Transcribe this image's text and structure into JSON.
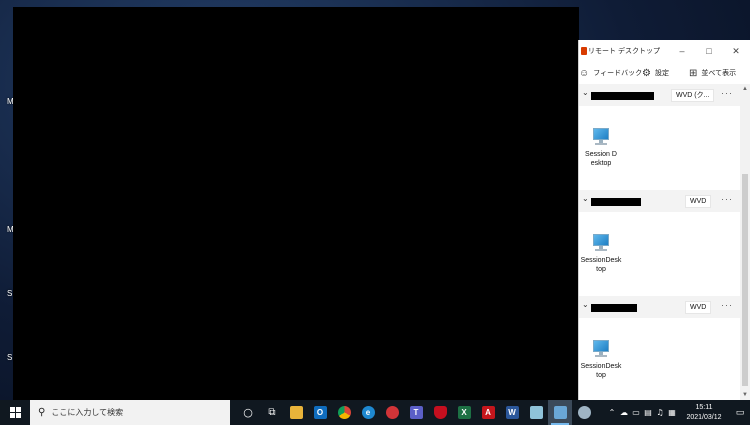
{
  "desktop": {
    "icon_letters": [
      "M",
      "M",
      "S",
      "S"
    ]
  },
  "remote_desktop": {
    "title": "リモート デスクトップ",
    "toolbar": {
      "feedback": "フィードバック",
      "settings": "設定",
      "view": "並べて表示"
    },
    "workspaces": [
      {
        "badge": "WVD (ク...",
        "more": "···",
        "sessions": [
          "Session Desktop"
        ]
      },
      {
        "badge": "WVD",
        "more": "···",
        "sessions": [
          "SessionDesktop"
        ]
      },
      {
        "badge": "WVD",
        "more": "···",
        "sessions": [
          "SessionDesktop"
        ]
      }
    ]
  },
  "taskbar": {
    "search_placeholder": "ここに入力して検索",
    "apps": [
      {
        "name": "cortana-icon",
        "glyph": "○"
      },
      {
        "name": "task-view-icon",
        "glyph": "⧉"
      },
      {
        "name": "file-explorer-icon",
        "glyph": ""
      },
      {
        "name": "outlook-icon",
        "glyph": "O"
      },
      {
        "name": "chrome-icon",
        "glyph": ""
      },
      {
        "name": "edge-icon",
        "glyph": "e"
      },
      {
        "name": "app-red-icon",
        "glyph": ""
      },
      {
        "name": "teams-icon",
        "glyph": "T"
      },
      {
        "name": "shield-app-icon",
        "glyph": ""
      },
      {
        "name": "excel-icon",
        "glyph": "X"
      },
      {
        "name": "acrobat-icon",
        "glyph": "A"
      },
      {
        "name": "word-icon",
        "glyph": "W"
      },
      {
        "name": "notepad-icon",
        "glyph": ""
      },
      {
        "name": "remote-desktop-icon",
        "glyph": ""
      },
      {
        "name": "snipping-icon",
        "glyph": ""
      }
    ],
    "clock_time": "15:11",
    "clock_date": "2021/03/12"
  },
  "colors": {
    "taskbar_bg": "#101820",
    "accent": "#76b9ed",
    "outlook": "#0f6cbd",
    "excel": "#1d7044",
    "word": "#2b579a",
    "acrobat": "#c4161c",
    "edge": "#1e88d0"
  }
}
